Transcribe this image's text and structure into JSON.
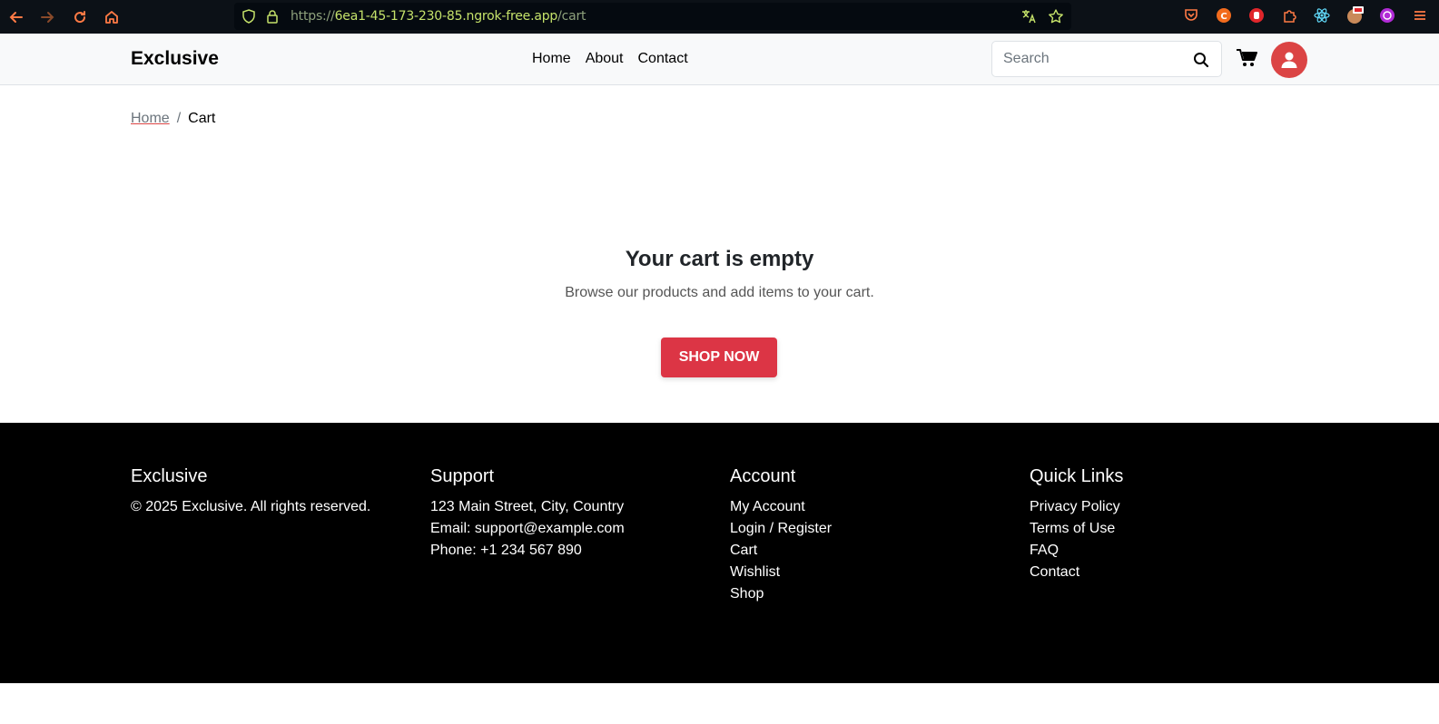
{
  "browser": {
    "url_prefix": "https://",
    "url_host": "6ea1-45-173-230-85.ngrok-free.app",
    "url_path": "/cart"
  },
  "header": {
    "logo": "Exclusive",
    "nav": [
      "Home",
      "About",
      "Contact"
    ],
    "search_placeholder": "Search"
  },
  "breadcrumb": {
    "home": "Home",
    "separator": "/",
    "current": "Cart"
  },
  "empty_cart": {
    "title": "Your cart is empty",
    "subtitle": "Browse our products and add items to your cart.",
    "button": "SHOP NOW"
  },
  "footer": {
    "brand": {
      "title": "Exclusive",
      "copyright": "© 2025 Exclusive. All rights reserved."
    },
    "support": {
      "title": "Support",
      "address": "123 Main Street, City, Country",
      "email": "Email: support@example.com",
      "phone": "Phone: +1 234 567 890"
    },
    "account": {
      "title": "Account",
      "links": [
        "My Account",
        "Login / Register",
        "Cart",
        "Wishlist",
        "Shop"
      ]
    },
    "quick_links": {
      "title": "Quick Links",
      "links": [
        "Privacy Policy",
        "Terms of Use",
        "FAQ",
        "Contact"
      ]
    }
  },
  "colors": {
    "accent": "#db4444",
    "button": "#dc3545",
    "footer_bg": "#000000",
    "header_bg": "#f8f9fa"
  }
}
